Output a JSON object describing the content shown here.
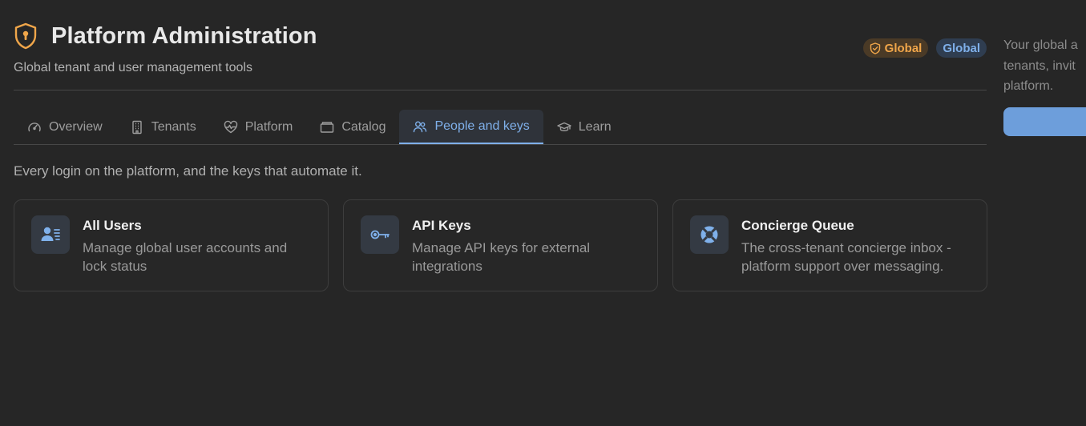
{
  "header": {
    "title": "Platform Administration",
    "subtitle": "Global tenant and user management tools",
    "badges": [
      {
        "label": "Global",
        "icon": "shield-check-icon",
        "color": "#f0a64a"
      },
      {
        "label": "Global",
        "color": "#7fb0ea"
      }
    ]
  },
  "tabs": [
    {
      "label": "Overview",
      "icon": "gauge-icon"
    },
    {
      "label": "Tenants",
      "icon": "building-icon"
    },
    {
      "label": "Platform",
      "icon": "heart-pulse-icon"
    },
    {
      "label": "Catalog",
      "icon": "archive-icon"
    },
    {
      "label": "People and keys",
      "icon": "users-icon",
      "active": true
    },
    {
      "label": "Learn",
      "icon": "graduation-cap-icon"
    }
  ],
  "lede": "Every login on the platform, and the keys that automate it.",
  "cards": [
    {
      "title": "All Users",
      "description": "Manage global user accounts and lock status",
      "icon": "user-card-icon"
    },
    {
      "title": "API Keys",
      "description": "Manage API keys for external integrations",
      "icon": "key-icon"
    },
    {
      "title": "Concierge Queue",
      "description": "The cross-tenant concierge inbox - platform support over messaging.",
      "icon": "life-buoy-icon"
    }
  ],
  "side_panel": {
    "text": "Your global a\ntenants, invit\nplatform."
  },
  "colors": {
    "background": "#262626",
    "accent": "#7fb0ea",
    "warning": "#f0a64a"
  }
}
